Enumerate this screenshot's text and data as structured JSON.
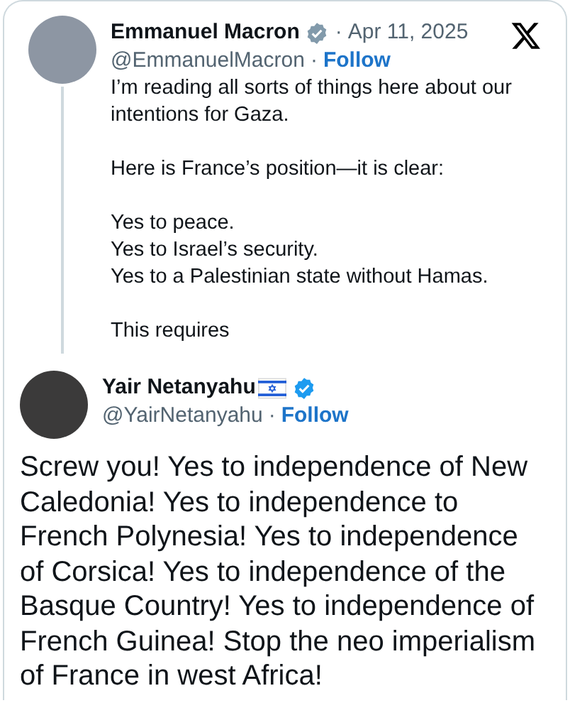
{
  "tweets": [
    {
      "kind": "quoted",
      "name": "Emmanuel Macron",
      "badge": {
        "color": "#829aab"
      },
      "date_separator": "·",
      "date": "Apr 11, 2025",
      "handle": "@EmmanuelMacron",
      "follow_separator": "·",
      "follow": "Follow",
      "paragraphs": [
        [
          "I’m reading all sorts of things here about our intentions for Gaza."
        ],
        [
          "Here is France’s position—it is clear:"
        ],
        [
          "Yes to peace.",
          "Yes to Israel’s security.",
          "Yes to a Palestinian state without Hamas."
        ],
        [
          "This requires"
        ]
      ]
    },
    {
      "kind": "reply",
      "name": "Yair Netanyahu",
      "flag": true,
      "badge": {
        "color": "#1d9bf0"
      },
      "handle": "@YairNetanyahu",
      "follow_separator": "·",
      "follow": "Follow",
      "paragraphs": [
        [
          "Screw you! Yes to independence of New Caledonia! Yes to independence to French Polynesia! Yes to independence of Corsica! Yes to independence of the Basque Country! Yes to independence of French Guinea! Stop the neo imperialism of France in west Africa!"
        ]
      ]
    }
  ]
}
